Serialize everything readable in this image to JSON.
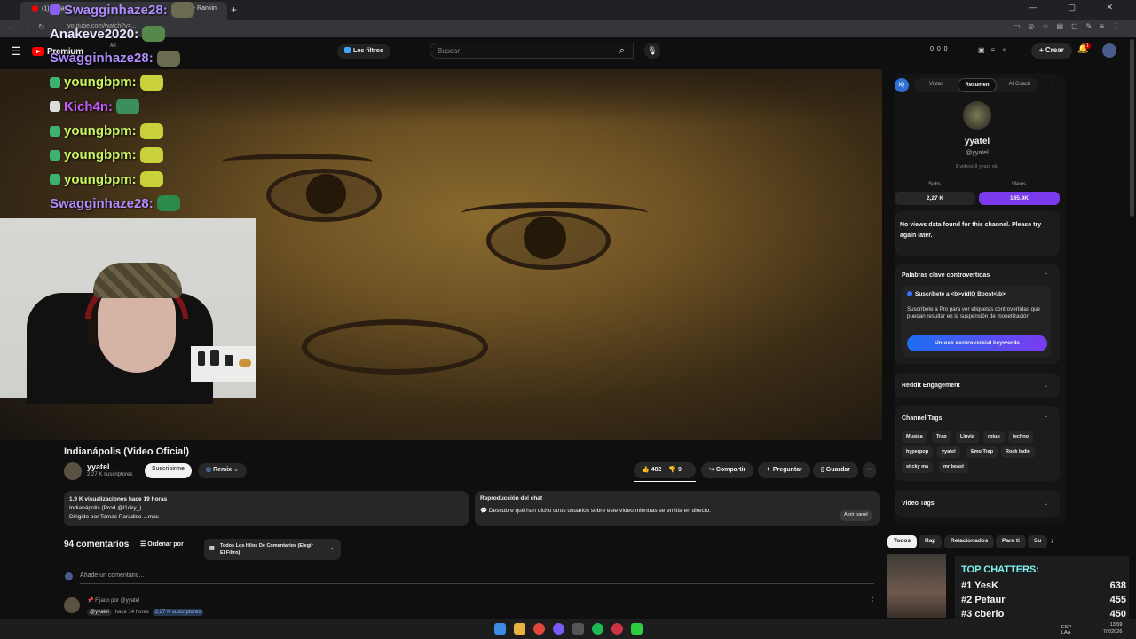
{
  "browser": {
    "tab_title": "(1) Indianápolis (Video Oficial) - YouTube",
    "tab_title_visible": "(1) India",
    "tab_title_tail": "p - Rankin",
    "new_tab": "+",
    "url": "youtube.com/watch?v=..."
  },
  "header": {
    "logo_text": "Premium",
    "logo_region": "AR",
    "filters_label": "Los filtros",
    "search_placeholder": "Buscar",
    "counters": "0  0  0",
    "crear_label": "Crear",
    "bell_badge": "1"
  },
  "chat_overlay": [
    {
      "user": "Swagginhaze28:",
      "color": "#b18cff"
    },
    {
      "user": "Anakeve2020:",
      "color": "#e8e8ff"
    },
    {
      "user": "Swagginhaze28:",
      "color": "#b18cff"
    },
    {
      "user": "youngbpm:",
      "color": "#c9f562"
    },
    {
      "user": "Kich4n:",
      "color": "#c25bff"
    },
    {
      "user": "youngbpm:",
      "color": "#c9f562"
    },
    {
      "user": "youngbpm:",
      "color": "#c9f562"
    },
    {
      "user": "youngbpm:",
      "color": "#c9f562"
    },
    {
      "user": "Swagginhaze28:",
      "color": "#b18cff"
    }
  ],
  "video": {
    "title": "Indianápolis (Video Oficial)",
    "channel": "yyatel",
    "subs": "2,27 K suscriptores",
    "subscribe": "Suscribirme",
    "remix": "Remix",
    "likes": "482",
    "dislikes": "9",
    "share": "Compartir",
    "ask": "Preguntar",
    "save": "Guardar",
    "more": "⋯"
  },
  "description": {
    "stats": "1,9 K visualizaciones  hace 19 horas",
    "line2": "Indianápolis (Prod @l1cky_)",
    "line3": "Dirigido por Tomas Paradiso",
    "more": "...más"
  },
  "chat_replay": {
    "title": "Reproducción del chat",
    "text": "Descubre qué han dicho otros usuarios sobre este vídeo mientras se emitía en directo.",
    "button": "Abrir panel"
  },
  "comments": {
    "count": "94 comentarios",
    "order": "Ordenar por",
    "threads_line1": "Todos Los Hilos De Comentarios (Elegir",
    "threads_line2": "El Filtro)",
    "add_placeholder": "Añade un comentario...",
    "pinned": "Fijado por @yyatel",
    "pin_user": "@yyatel",
    "pin_time": "hace 14 horas",
    "pin_subs": "2,27 K suscriptores"
  },
  "panel": {
    "tabs": [
      "Vistas",
      "Resumen",
      "AI Coach"
    ],
    "iq": "IQ",
    "name": "yyatel",
    "handle": "@yyatel",
    "stats": "9 videos   9 years old",
    "subs_label": "Subs",
    "subs_value": "2,27 K",
    "views_label": "Views",
    "views_value": "145.9K",
    "no_views": "No views data found for this channel. Please try again later.",
    "kw_title": "Palabras clave controvertidas",
    "pro_title": "Suscríbete a <b>vidIQ Boost</b>",
    "pro_text": "Suscríbete a Pro para ver etiquetas controvertidas que puedan resultar en la suspensión de monetización",
    "unlock": "Unlock controversial keywords",
    "reddit": "Reddit Engagement",
    "channel_tags": "Channel Tags",
    "tags": [
      "Musica",
      "Trap",
      "Lluvia",
      "rojuu",
      "techno",
      "hyperpop",
      "yyatel",
      "Emo Trap",
      "Rock Indie",
      "sticky ma",
      "mr beast"
    ],
    "video_tags": "Video Tags"
  },
  "chips": [
    "Todos",
    "Rap",
    "Relacionados",
    "Para ti",
    "Su"
  ],
  "top_chatters": {
    "title": "TOP CHATTERS:",
    "rows": [
      {
        "rank": "#1",
        "name": "YesK",
        "count": "638"
      },
      {
        "rank": "#2",
        "name": "Pefaur",
        "count": "455"
      },
      {
        "rank": "#3",
        "name": "cberlo",
        "count": "450"
      }
    ]
  },
  "taskbar": {
    "lang1": "ESP",
    "lang2": "LAA",
    "time": "13:59",
    "date": "7/2/2026"
  },
  "colors": {
    "accent": "#7c3aed",
    "youtube_red": "#ff0000",
    "vidiq_blue": "#2f6fd8"
  }
}
